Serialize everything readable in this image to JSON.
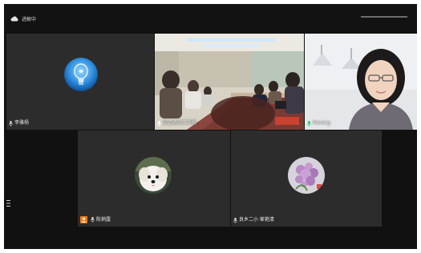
{
  "status_bar": {
    "status_icon": "cloud-icon",
    "status_text": "进解中"
  },
  "participants": [
    {
      "name": "李雅杨",
      "tile": "avatar-lightbulb",
      "mic_icon": "mic-icon"
    },
    {
      "name": "防边进校王洪梅",
      "tile": "video-meeting-room",
      "mic_icon": "mic-icon"
    },
    {
      "name": "Maning",
      "tile": "video-woman-glasses",
      "mic_icon": "mic-icon"
    },
    {
      "name": "陈梢露",
      "tile": "avatar-dog",
      "mic_icon": "mic-icon",
      "host": true
    },
    {
      "name": "良乡二小 崔艳清",
      "tile": "avatar-flower",
      "mic_icon": "mic-icon"
    }
  ],
  "colors": {
    "background": "#111111",
    "tile": "#2c2c2c",
    "host_badge": "#ef7b1a",
    "mic_active": "#22c55e"
  },
  "side_handle_icon": "menu-handle-icon"
}
